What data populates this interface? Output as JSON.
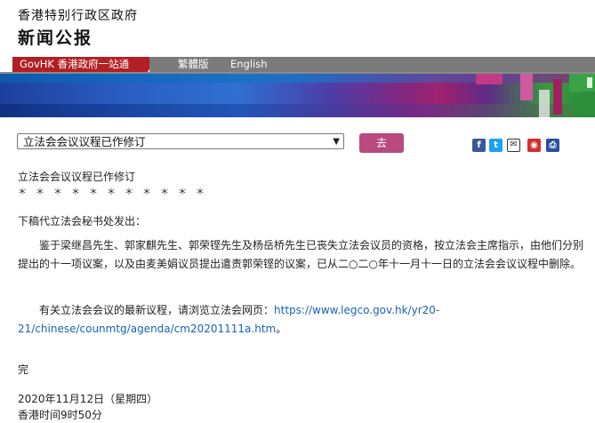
{
  "header": {
    "government": "香港特别行政区政府",
    "press_title": "新闻公报"
  },
  "nav": {
    "govhk": "GovHK 香港政府一站通",
    "traditional": "繁體版",
    "english": "English"
  },
  "controls": {
    "selected_title": "立法会会议议程已作修订",
    "go_label": "去"
  },
  "share_icons": [
    "facebook-icon",
    "twitter-icon",
    "email-icon",
    "weibo-icon",
    "print-icon"
  ],
  "article": {
    "title": "立法会会议议程已作修订",
    "stars": "＊　＊　＊　＊　＊　＊　＊　＊　＊　＊　＊",
    "intro": "下稿代立法会秘书处发出：",
    "para1": "　　鉴于梁继昌先生、郭家麒先生、郭荣铿先生及杨岳桥先生已丧失立法会议员的资格，按立法会主席指示，由他们分别提出的十一项议案，以及由麦美娟议员提出遣责郭荣铿的议案，已从二○二○年十一月十一日的立法会会议议程中删除。",
    "para2_text": "　　有关立法会会议的最新议程，请浏览立法会网页：",
    "para2_link": "https://www.legco.gov.hk/yr20-21/chinese/counmtg/agenda/cm20201111a.htm",
    "para2_end": "。",
    "end": "完",
    "date": "2020年11月12日（星期四）",
    "time": "香港时间9时50分"
  },
  "colors": {
    "govhk_tab": "#b21f24",
    "lang_tab": "#7b7b7b",
    "go_button": "#b84a80",
    "link": "#1a62b5"
  }
}
